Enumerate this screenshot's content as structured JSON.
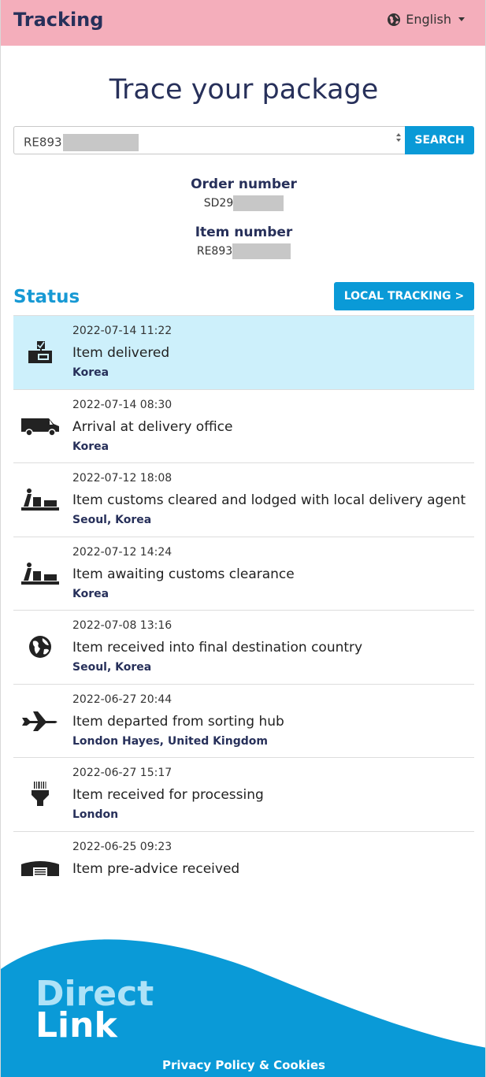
{
  "header": {
    "title": "Tracking",
    "language": "English",
    "language_icon": "globe-icon"
  },
  "page_title": "Trace your package",
  "search": {
    "value_prefix": "RE893",
    "button_label": "SEARCH"
  },
  "order": {
    "label": "Order number",
    "value_prefix": "SD29"
  },
  "item": {
    "label": "Item number",
    "value_prefix": "RE893"
  },
  "status": {
    "title": "Status",
    "local_button": "LOCAL TRACKING >"
  },
  "events": [
    {
      "time": "2022-07-14 11:22",
      "description": "Item delivered",
      "location": "Korea",
      "icon": "delivered-icon",
      "highlight": true
    },
    {
      "time": "2022-07-14 08:30",
      "description": "Arrival at delivery office",
      "location": "Korea",
      "icon": "van-icon"
    },
    {
      "time": "2022-07-12 18:08",
      "description": "Item customs cleared and lodged with local delivery agent",
      "location": "Seoul, Korea",
      "icon": "customs-icon"
    },
    {
      "time": "2022-07-12 14:24",
      "description": "Item awaiting customs clearance",
      "location": "Korea",
      "icon": "customs-icon"
    },
    {
      "time": "2022-07-08 13:16",
      "description": "Item received into final destination country",
      "location": "Seoul, Korea",
      "icon": "globe-icon"
    },
    {
      "time": "2022-06-27 20:44",
      "description": "Item departed from sorting hub",
      "location": "London Hayes, United Kingdom",
      "icon": "plane-icon"
    },
    {
      "time": "2022-06-27 15:17",
      "description": "Item received for processing",
      "location": "London",
      "icon": "scanner-icon"
    },
    {
      "time": "2022-06-25 09:23",
      "description": "Item pre-advice received",
      "location": "",
      "icon": "warehouse-icon"
    }
  ],
  "footer": {
    "logo_line1": "Direct",
    "logo_line2": "Link",
    "privacy": "Privacy Policy & Cookies"
  },
  "colors": {
    "header_bg": "#f4aebb",
    "accent": "#0a9ad7",
    "navy": "#27305a",
    "highlight": "#cdf0fb"
  }
}
